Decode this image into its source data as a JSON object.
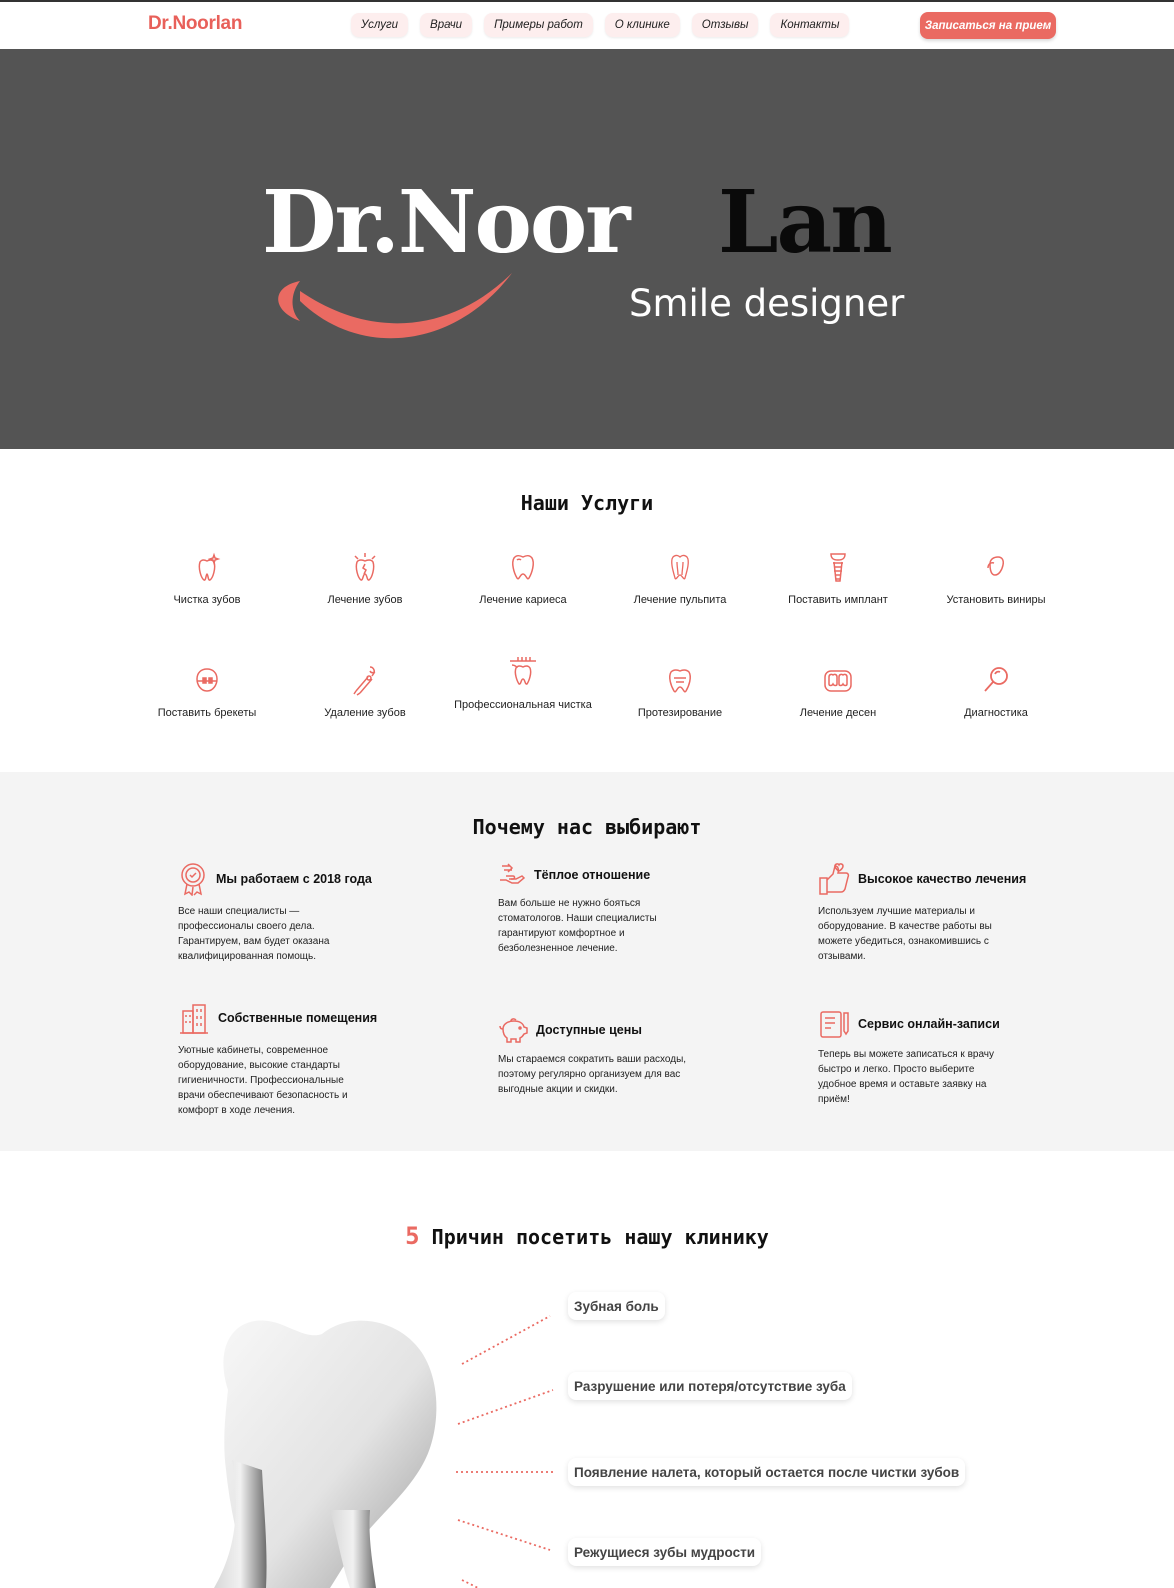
{
  "header": {
    "brand": "Dr.Noorlan",
    "nav": [
      "Услуги",
      "Врачи",
      "Примеры работ",
      "О клинике",
      "Отзывы",
      "Контакты"
    ],
    "cta": "Записаться на прием"
  },
  "hero": {
    "logo_white": "Dr.Noor",
    "logo_black": "Lan",
    "tagline": "Smile designer"
  },
  "services": {
    "title": "Наши Услуги",
    "items": [
      {
        "label": "Чистка зубов",
        "icon": "sparkling-tooth-icon"
      },
      {
        "label": "Лечение зубов",
        "icon": "tooth-pain-icon"
      },
      {
        "label": "Лечение кариеса",
        "icon": "tooth-icon"
      },
      {
        "label": "Лечение пульпита",
        "icon": "tooth-root-icon"
      },
      {
        "label": "Поставить имплант",
        "icon": "implant-icon"
      },
      {
        "label": "Установить виниры",
        "icon": "veneer-icon"
      },
      {
        "label": "Поставить брекеты",
        "icon": "braces-icon"
      },
      {
        "label": "Удаление зубов",
        "icon": "forceps-icon"
      },
      {
        "label": "Профессиональная чистка",
        "icon": "toothbrush-icon"
      },
      {
        "label": "Протезирование",
        "icon": "prosthesis-icon"
      },
      {
        "label": "Лечение десен",
        "icon": "gums-icon"
      },
      {
        "label": "Диагностика",
        "icon": "magnifier-icon"
      }
    ]
  },
  "why": {
    "title": "Почему нас выбирают",
    "items": [
      {
        "title": "Мы работаем с 2018 года",
        "text": "Все наши специалисты — профессионалы своего дела. Гарантируем, вам будет оказана квалифицированная помощь.",
        "icon": "award-icon"
      },
      {
        "title": "Тёплое отношение",
        "text": "Вам больше не нужно бояться стоматологов. Наши специалисты гарантируют комфортное и безболезненное лечение.",
        "icon": "care-hand-icon"
      },
      {
        "title": "Высокое качество лечения",
        "text": "Используем лучшие материалы и оборудование. В качестве работы вы можете убедиться, ознакомившись с отзывами.",
        "icon": "thumbs-up-icon"
      },
      {
        "title": "Собственные помещения",
        "text": "Уютные кабинеты, современное оборудование, высокие стандарты гигиеничности. Профессиональные врачи обеспечивают безопасность и комфорт в ходе лечения.",
        "icon": "building-icon"
      },
      {
        "title": "Доступные цены",
        "text": "Мы стараемся сократить ваши расходы, поэтому регулярно организуем для вас выгодные акции и скидки.",
        "icon": "piggy-bank-icon"
      },
      {
        "title": "Сервис онлайн-записи",
        "text": "Теперь вы можете записаться к врачу быстро и легко. Просто выберите удобное время и оставьте заявку на приём!",
        "icon": "online-form-icon"
      }
    ]
  },
  "reasons": {
    "number": "5",
    "title": "Причин посетить нашу клинику",
    "items": [
      "Зубная боль",
      "Разрушение или потеря/отсутствие зуба",
      "Появление налета, который остается после чистки зубов",
      "Режущиеся зубы мудрости"
    ]
  },
  "colors": {
    "accent": "#ea6a62",
    "hero_bg": "#545454",
    "why_bg": "#f4f4f4"
  }
}
